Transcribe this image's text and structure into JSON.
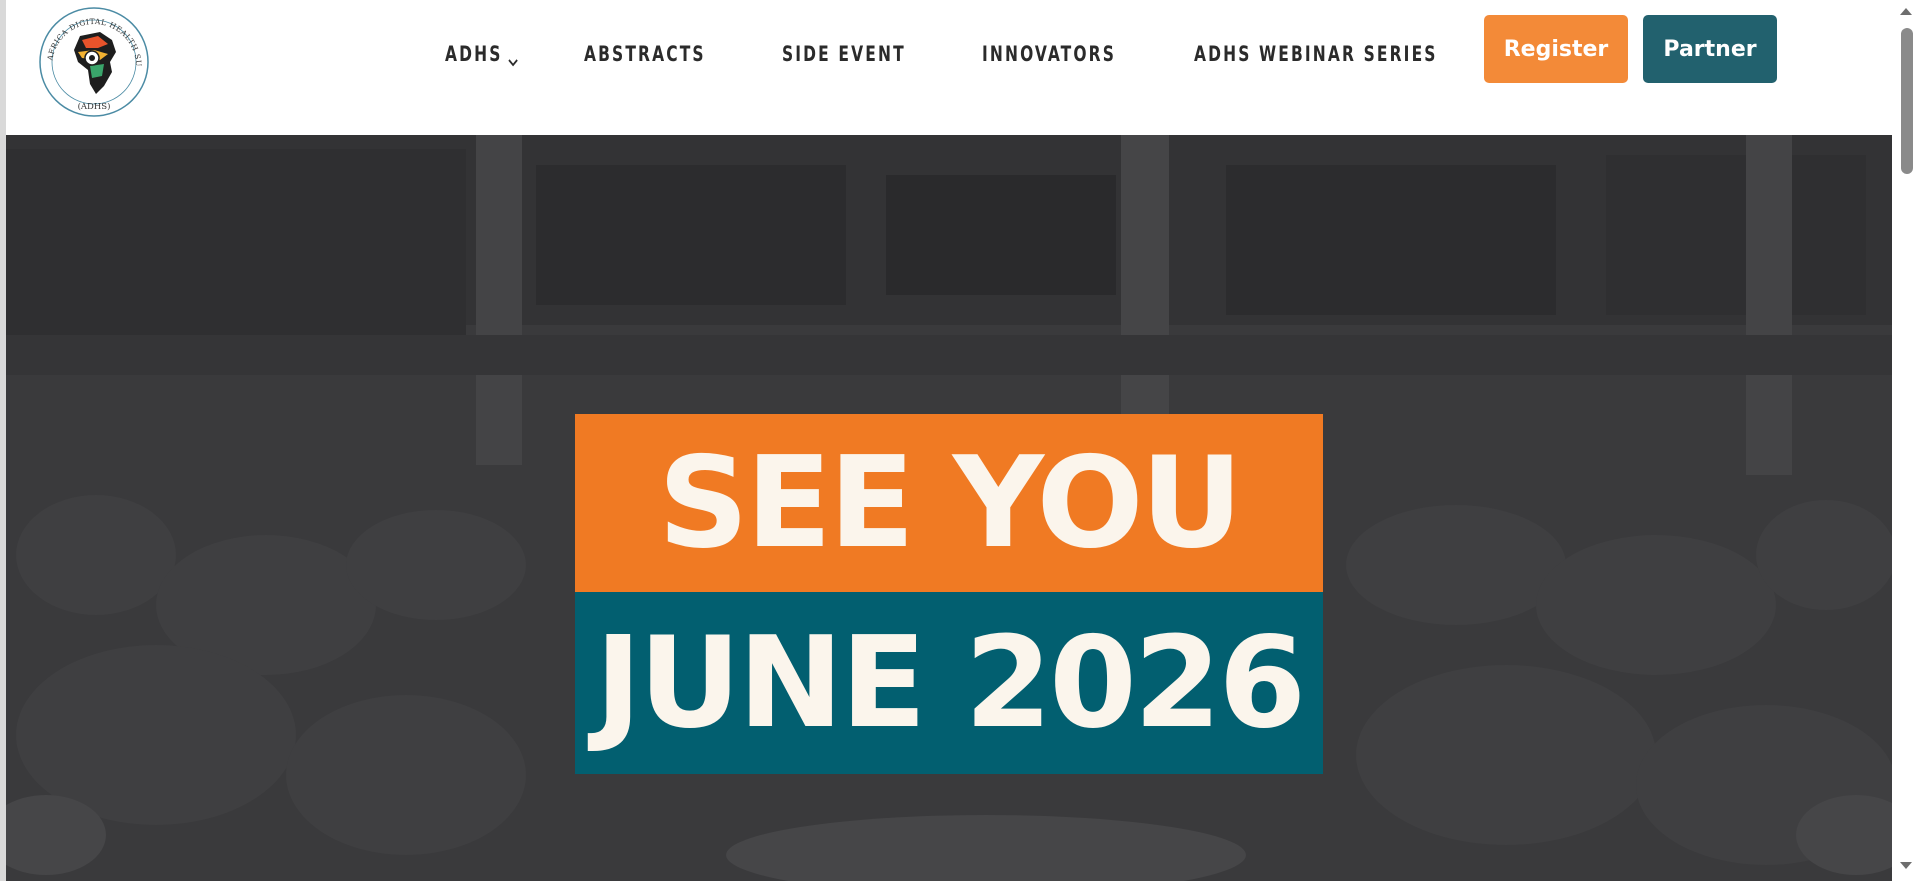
{
  "logo": {
    "ring_text": "AFRICA DIGITAL HEALTH SUMMIT",
    "short_name": "(ADHS)"
  },
  "nav": {
    "items": [
      {
        "label": "ADHS",
        "has_dropdown": true
      },
      {
        "label": "ABSTRACTS",
        "has_dropdown": false
      },
      {
        "label": "SIDE EVENT",
        "has_dropdown": false
      },
      {
        "label": "INNOVATORS",
        "has_dropdown": false
      },
      {
        "label": "ADHS WEBINAR SERIES",
        "has_dropdown": false
      }
    ]
  },
  "actions": {
    "register_label": "Register",
    "partner_label": "Partner"
  },
  "hero": {
    "line1": "SEE YOU",
    "line2": "JUNE 2026"
  },
  "colors": {
    "register": "#f38a38",
    "partner": "#22616e",
    "banner_orange": "#f07a23",
    "banner_teal": "#025f70",
    "hero_overlay": "#3a3a3c"
  },
  "icons": [
    "chevron-down-icon",
    "scroll-up-arrow-icon",
    "scroll-down-arrow-icon"
  ]
}
